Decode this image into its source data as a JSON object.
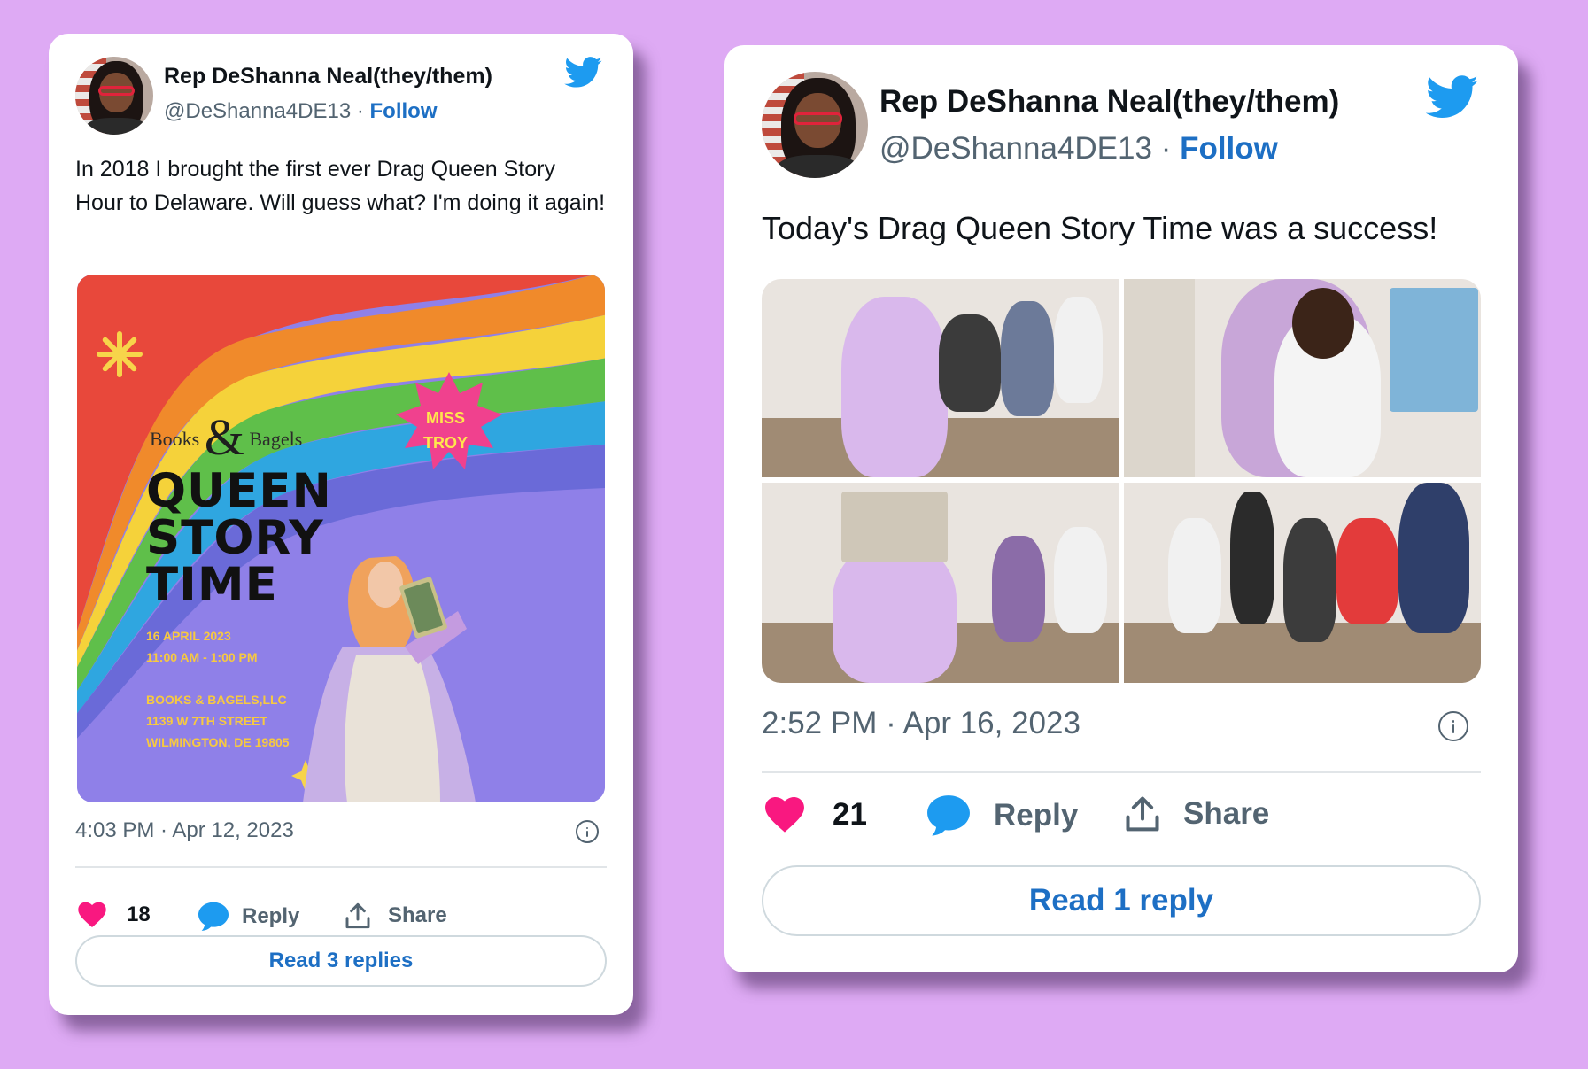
{
  "tweets": [
    {
      "author_name": "Rep DeShanna Neal(they/them)",
      "handle": "@DeShanna4DE13",
      "separator": " · ",
      "follow_label": "Follow",
      "text": "In 2018 I brought the first ever Drag Queen Story Hour to Delaware. Will guess what? I'm doing it again!",
      "timestamp": "4:03 PM · Apr 12, 2023",
      "likes": "18",
      "reply_label": "Reply",
      "share_label": "Share",
      "read_replies": "Read 3 replies",
      "poster": {
        "brand_left": "Books",
        "brand_amp": "&",
        "brand_right": "Bagels",
        "title_line1": "QUEEN",
        "title_line2": "STORY",
        "title_line3": "TIME",
        "date": "16 APRIL 2023",
        "time": "11:00 AM - 1:00 PM",
        "venue": "BOOKS & BAGELS,LLC",
        "street": "1139 W 7TH STREET",
        "city": "WILMINGTON, DE 19805",
        "badge_line1": "MISS",
        "badge_line2": "TROY"
      }
    },
    {
      "author_name": "Rep DeShanna Neal(they/them)",
      "handle": "@DeShanna4DE13",
      "separator": " · ",
      "follow_label": "Follow",
      "text": "Today's Drag Queen Story Time was a success!",
      "timestamp": "2:52 PM · Apr 16, 2023",
      "likes": "21",
      "reply_label": "Reply",
      "share_label": "Share",
      "read_replies": "Read 1 reply"
    }
  ],
  "colors": {
    "background": "#deaaf4",
    "link_blue": "#1d6fc4",
    "twitter_blue": "#1d9bf0",
    "heart_pink": "#f91880"
  },
  "icons": [
    "twitter-bird-icon",
    "heart-icon",
    "reply-bubble-icon",
    "share-icon",
    "info-icon"
  ]
}
